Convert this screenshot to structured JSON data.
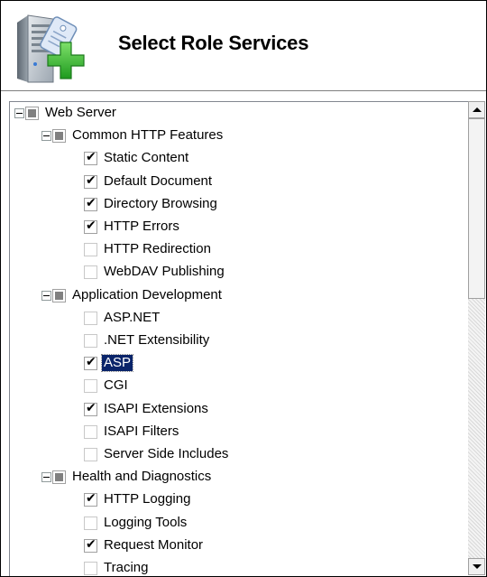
{
  "header": {
    "title": "Select Role Services",
    "icon": "server-add-icon"
  },
  "colors": {
    "selection_bg": "#0a246a",
    "selection_fg": "#ffffff",
    "border": "#000000"
  },
  "tree": {
    "items": [
      {
        "label": "Web Server",
        "level": 0,
        "state": "partial",
        "expandable": true,
        "expanded": true
      },
      {
        "label": "Common HTTP Features",
        "level": 1,
        "state": "partial",
        "expandable": true,
        "expanded": true
      },
      {
        "label": "Static Content",
        "level": 2,
        "state": "checked"
      },
      {
        "label": "Default Document",
        "level": 2,
        "state": "checked"
      },
      {
        "label": "Directory Browsing",
        "level": 2,
        "state": "checked"
      },
      {
        "label": "HTTP Errors",
        "level": 2,
        "state": "checked"
      },
      {
        "label": "HTTP Redirection",
        "level": 2,
        "state": "unchecked"
      },
      {
        "label": "WebDAV Publishing",
        "level": 2,
        "state": "unchecked"
      },
      {
        "label": "Application Development",
        "level": 1,
        "state": "partial",
        "expandable": true,
        "expanded": true
      },
      {
        "label": "ASP.NET",
        "level": 2,
        "state": "unchecked"
      },
      {
        "label": ".NET Extensibility",
        "level": 2,
        "state": "unchecked"
      },
      {
        "label": "ASP",
        "level": 2,
        "state": "checked",
        "selected": true
      },
      {
        "label": "CGI",
        "level": 2,
        "state": "unchecked"
      },
      {
        "label": "ISAPI Extensions",
        "level": 2,
        "state": "checked"
      },
      {
        "label": "ISAPI Filters",
        "level": 2,
        "state": "unchecked"
      },
      {
        "label": "Server Side Includes",
        "level": 2,
        "state": "unchecked"
      },
      {
        "label": "Health and Diagnostics",
        "level": 1,
        "state": "partial",
        "expandable": true,
        "expanded": true
      },
      {
        "label": "HTTP Logging",
        "level": 2,
        "state": "checked"
      },
      {
        "label": "Logging Tools",
        "level": 2,
        "state": "unchecked"
      },
      {
        "label": "Request Monitor",
        "level": 2,
        "state": "checked"
      },
      {
        "label": "Tracing",
        "level": 2,
        "state": "unchecked"
      }
    ]
  }
}
